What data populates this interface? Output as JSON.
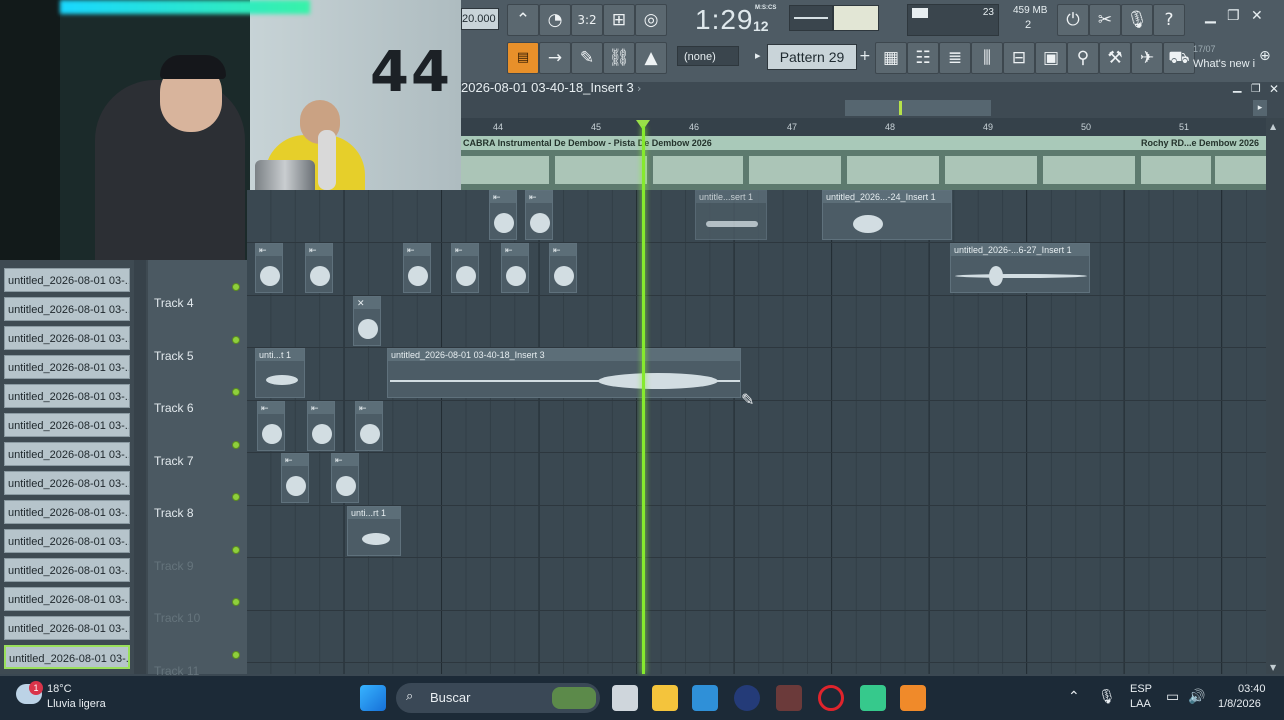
{
  "toolbar": {
    "tempo": "20.000",
    "time_main": "1:29",
    "time_sub": "12",
    "time_format": "M:S:CS",
    "cpu_value": "23",
    "memory": "459 MB",
    "voices": "2",
    "snap": "(none)",
    "pattern": "Pattern 29",
    "news_date": "17/07",
    "news_text": "What's new i"
  },
  "playlist": {
    "title": "2026-08-01 03-40-18_Insert 3",
    "ruler": [
      "44",
      "45",
      "46",
      "47",
      "48",
      "49",
      "50",
      "51"
    ],
    "audio_clip_1": "CABRA Instrumental De Dembow - Pista De Dembow 2026",
    "audio_clip_2": "Rochy RD...e Dembow 2026",
    "tracks": [
      "Track 4",
      "Track 5",
      "Track 6",
      "Track 7",
      "Track 8",
      "Track 9",
      "Track 10",
      "Track 11"
    ],
    "clips": {
      "t2a": "untitle...sert 1",
      "t2b": "untitled_2026...-24_Insert 1",
      "t3a": "untitled_2026-...6-27_Insert 1",
      "t5a": "unti...t 1",
      "t5b": "untitled_2026-08-01 03-40-18_Insert 3",
      "t8a": "unti...rt 1"
    }
  },
  "picker": {
    "items": [
      "untitled_2026-08-01 03-...",
      "untitled_2026-08-01 03-...",
      "untitled_2026-08-01 03-...",
      "untitled_2026-08-01 03-...",
      "untitled_2026-08-01 03-...",
      "untitled_2026-08-01 03-...",
      "untitled_2026-08-01 03-...",
      "untitled_2026-08-01 03-...",
      "untitled_2026-08-01 03-...",
      "untitled_2026-08-01 03-...",
      "untitled_2026-08-01 03-...",
      "untitled_2026-08-01 03-...",
      "untitled_2026-08-01 03-...",
      "untitled_2026-08-01 03-..."
    ]
  },
  "taskbar": {
    "weather_temp": "18°C",
    "weather_desc": "Lluvia ligera",
    "search_placeholder": "Buscar",
    "lang": "ESP",
    "layout": "LAA",
    "clock_time": "03:40",
    "clock_date": "1/8/2026",
    "notif_badge": "1"
  },
  "colors": {
    "playhead": "#86ea2e",
    "audio_clip": "#5d7a6e",
    "accent_orange": "#e8902a"
  }
}
